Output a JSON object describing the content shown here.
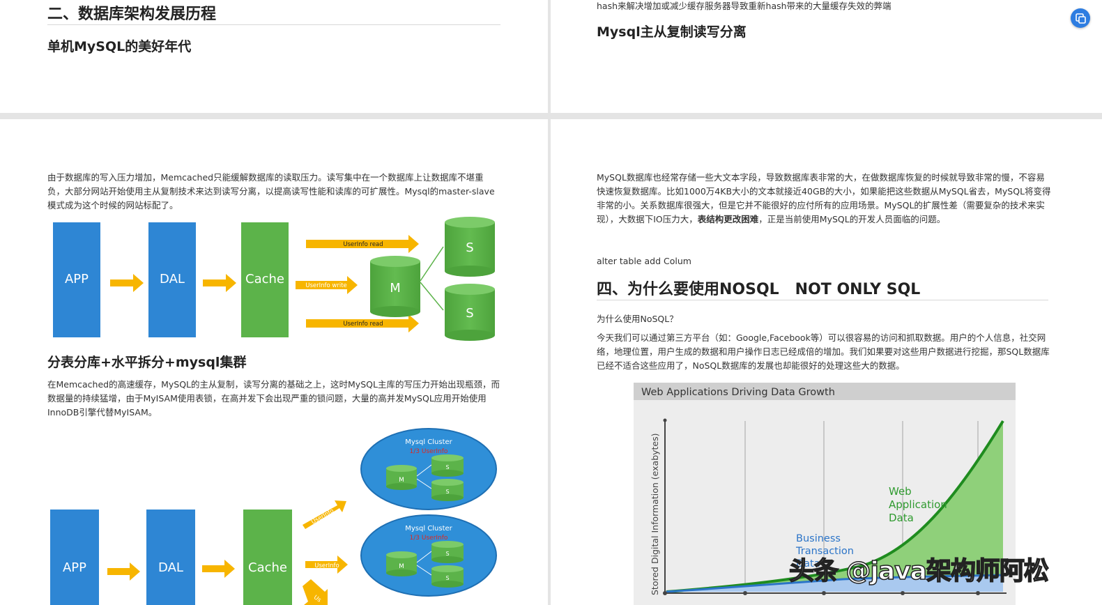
{
  "top_left": {
    "heading": "二、数据库架构发展历程",
    "subheading": "单机MySQL的美好年代"
  },
  "top_right": {
    "cut_line": "hash来解决增加或减少缓存服务器导致重新hash带来的大量缓存失效的弊端",
    "subheading": "Mysql主从复制读写分离"
  },
  "bottom_left": {
    "para1": "由于数据库的写入压力增加，Memcached只能缓解数据库的读取压力。读写集中在一个数据库上让数据库不堪重负，大部分网站开始使用主从复制技术来达到读写分离，以提高读写性能和读库的可扩展性。Mysql的master-slave模式成为这个时候的网站标配了。",
    "diagram1": {
      "app": "APP",
      "dal": "DAL",
      "cache": "Cache",
      "master": "M",
      "slave": "S",
      "read_label": "UserInfo  read",
      "write_label": "UserInfo  write",
      "blue": "#2e86d4",
      "green": "#5cb34a",
      "arrow": "#f7b500"
    },
    "heading2": "分表分库+水平拆分+mysql集群",
    "para2": "在Memcached的高速缓存，MySQL的主从复制，读写分离的基础之上，这时MySQL主库的写压力开始出现瓶颈，而数据量的持续猛增，由于MyISAM使用表锁，在高并发下会出现严重的锁问题，大量的高并发MySQL应用开始使用InnoDB引擎代替MyISAM。",
    "diagram2": {
      "app": "APP",
      "dal": "DAL",
      "cache": "Cache",
      "cluster_title": "Mysql Cluster",
      "cluster_sub": "1/3 UserInfo",
      "master": "M",
      "slave": "S",
      "arrow_label": "UserInfo",
      "arrow_label_cut": "Us"
    }
  },
  "bottom_right": {
    "para1_a": "MySQL数据库也经常存储一些大文本字段，导致数据库表非常的大，在做数据库恢复的时候就导致非常的慢，不容易快速恢复数据库。比如1000万4KB大小的文本就接近40GB的大小，如果能把这些数据从MySQL省去，MySQL将变得非常的小。关系数据库很强大，但是它并不能很好的应付所有的应用场景。MySQL的扩展性差（需要复杂的技术来实现），大数据下IO压力大，",
    "para1_bold": "表结构更改困难",
    "para1_b": "，正是当前使用MySQL的开发人员面临的问题。",
    "code_line": "alter table add Colum",
    "heading": "四、为什么要使用NOSQL   NOT ONLY SQL",
    "question": "为什么使用NoSQL？",
    "para2": "今天我们可以通过第三方平台（如：Google,Facebook等）可以很容易的访问和抓取数据。用户的个人信息，社交网络，地理位置，用户生成的数据和用户操作日志已经成倍的增加。我们如果要对这些用户数据进行挖掘，那SQL数据库已经不适合这些应用了，NoSQL数据库的发展也却能很好的处理这些大的数据。",
    "chart_data": {
      "type": "area",
      "title": "Web Applications Driving Data Growth",
      "ylabel": "Stored Digital Information (exabytes)",
      "xlabel": "",
      "series": [
        {
          "name": "Web Application Data",
          "color": "#2f9a2f",
          "fill": "#8fd07a"
        },
        {
          "name": "Business Transaction Data",
          "color": "#2b74c8",
          "fill": "#a9c9ef"
        }
      ],
      "grid": "vertical",
      "background": "#e8e8e8"
    }
  },
  "watermark": "头条 @java架构师阿松",
  "icons": {
    "floating_button": "translate-icon"
  }
}
